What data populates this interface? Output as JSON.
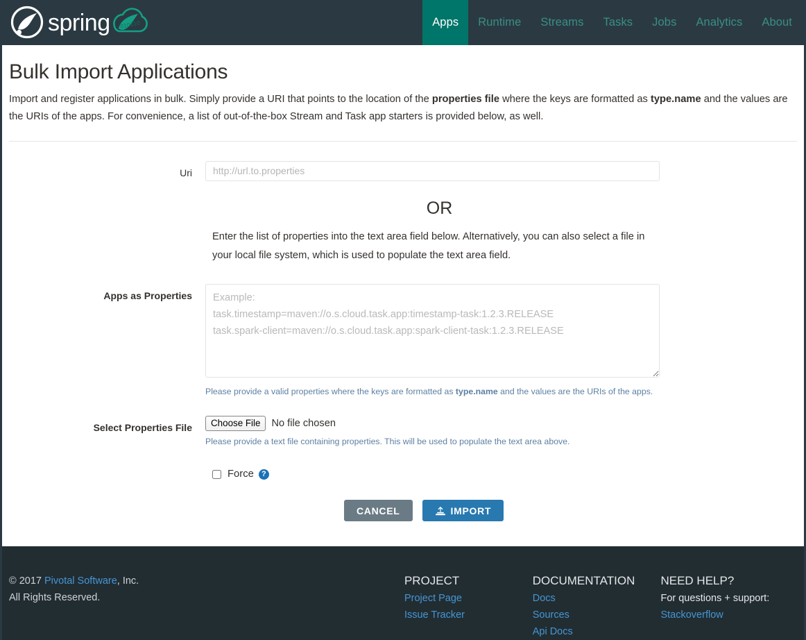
{
  "nav": {
    "brand_name": "spring",
    "brand_sub": "cloud dataflow",
    "items": [
      {
        "label": "Apps",
        "active": true
      },
      {
        "label": "Runtime",
        "active": false
      },
      {
        "label": "Streams",
        "active": false
      },
      {
        "label": "Tasks",
        "active": false
      },
      {
        "label": "Jobs",
        "active": false
      },
      {
        "label": "Analytics",
        "active": false
      },
      {
        "label": "About",
        "active": false
      }
    ]
  },
  "page": {
    "title": "Bulk Import Applications",
    "desc_part1": "Import and register applications in bulk. Simply provide a URI that points to the location of the ",
    "desc_bold1": "properties file",
    "desc_part2": " where the keys are formatted as ",
    "desc_bold2": "type.name",
    "desc_part3": " and the values are the URIs of the apps. For convenience, a list of out-of-the-box Stream and Task app starters is provided below, as well."
  },
  "form": {
    "uri_label": "Uri",
    "uri_value": "",
    "uri_placeholder": "http://url.to.properties",
    "or_title": "OR",
    "or_text": "Enter the list of properties into the text area field below. Alternatively, you can also select a file in your local file system, which is used to populate the text area field.",
    "props_label": "Apps as Properties",
    "props_value": "",
    "props_placeholder": "Example:\ntask.timestamp=maven://o.s.cloud.task.app:timestamp-task:1.2.3.RELEASE\ntask.spark-client=maven://o.s.cloud.task.app:spark-client-task:1.2.3.RELEASE",
    "props_help_part1": "Please provide a valid properties where the keys are formatted as ",
    "props_help_bold": "type.name",
    "props_help_part2": " and the values are the URIs of the apps.",
    "file_label": "Select Properties File",
    "file_button": "Choose File",
    "file_status": "No file chosen",
    "file_help": "Please provide a text file containing properties. This will be used to populate the text area above.",
    "force_label": "Force",
    "force_checked": false,
    "force_help_icon": "question-mark-icon",
    "cancel_button": "CANCEL",
    "import_button": "IMPORT",
    "import_icon": "import-upload-icon"
  },
  "footer": {
    "copyright_prefix": "© 2017 ",
    "copyright_link": "Pivotal Software",
    "copyright_suffix": ", Inc.",
    "rights": "All Rights Reserved.",
    "columns": [
      {
        "heading": "PROJECT",
        "links": [
          "Project Page",
          "Issue Tracker"
        ],
        "note": ""
      },
      {
        "heading": "DOCUMENTATION",
        "links": [
          "Docs",
          "Sources",
          "Api Docs"
        ],
        "note": ""
      },
      {
        "heading": "NEED HELP?",
        "links": [
          "Stackoverflow"
        ],
        "note": "For questions + support:"
      }
    ]
  },
  "colors": {
    "header_bg": "#2b3a42",
    "footer_bg": "#222d32",
    "accent_teal": "#00756a",
    "nav_link": "#3a8e87",
    "link_blue": "#4596d4",
    "primary_blue": "#2779b0",
    "cancel_gray": "#6b7b85",
    "help_text": "#5c7fa3"
  }
}
